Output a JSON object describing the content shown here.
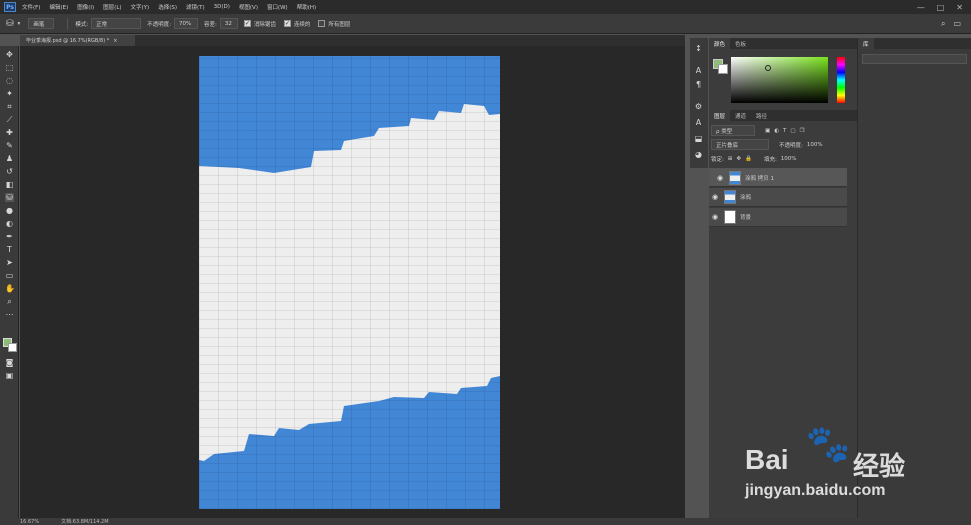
{
  "menubar": {
    "logo": "Ps",
    "items": [
      "文件(F)",
      "编辑(E)",
      "图像(I)",
      "图层(L)",
      "文字(Y)",
      "选择(S)",
      "滤镜(T)",
      "3D(D)",
      "视图(V)",
      "窗口(W)",
      "帮助(H)"
    ],
    "window_buttons": [
      "—",
      "□",
      "✕"
    ]
  },
  "options": {
    "preset": "画笔",
    "mode_label": "模式:",
    "mode_value": "正常",
    "opacity_label": "不透明度:",
    "opacity_value": "70%",
    "tolerance_label": "容差:",
    "tolerance_value": "32",
    "antialias_label": "消除锯齿",
    "contiguous_label": "连续的",
    "all_layers_label": "所有图层"
  },
  "tab": {
    "title": "毕业季海报.psd @ 16.7%(RGB/8) *",
    "close": "×"
  },
  "panels": {
    "color_tabs": [
      "颜色",
      "色板"
    ],
    "layer_tabs": [
      "图层",
      "通道",
      "路径"
    ],
    "far_tab": "库",
    "kind_label": "ρ 类型",
    "blend": "正片叠底",
    "opacity_label": "不透明度:",
    "opacity_value": "100%",
    "lock_label": "锁定:",
    "fill_label": "填充:",
    "fill_value": "100%",
    "colors": {
      "foreground": "#8dbd78",
      "background": "#ffffff"
    }
  },
  "layers": [
    {
      "name": "涂鸦 拷贝 1",
      "selected": true
    },
    {
      "name": "涂鸦",
      "selected": false
    },
    {
      "name": "背景",
      "selected": false
    }
  ],
  "status": {
    "zoom": "16.67%",
    "doc": "文档:63.8M/114.2M"
  },
  "watermark": {
    "brand": "Bai",
    "brand_suffix": "经验",
    "url": "jingyan.baidu.com"
  }
}
